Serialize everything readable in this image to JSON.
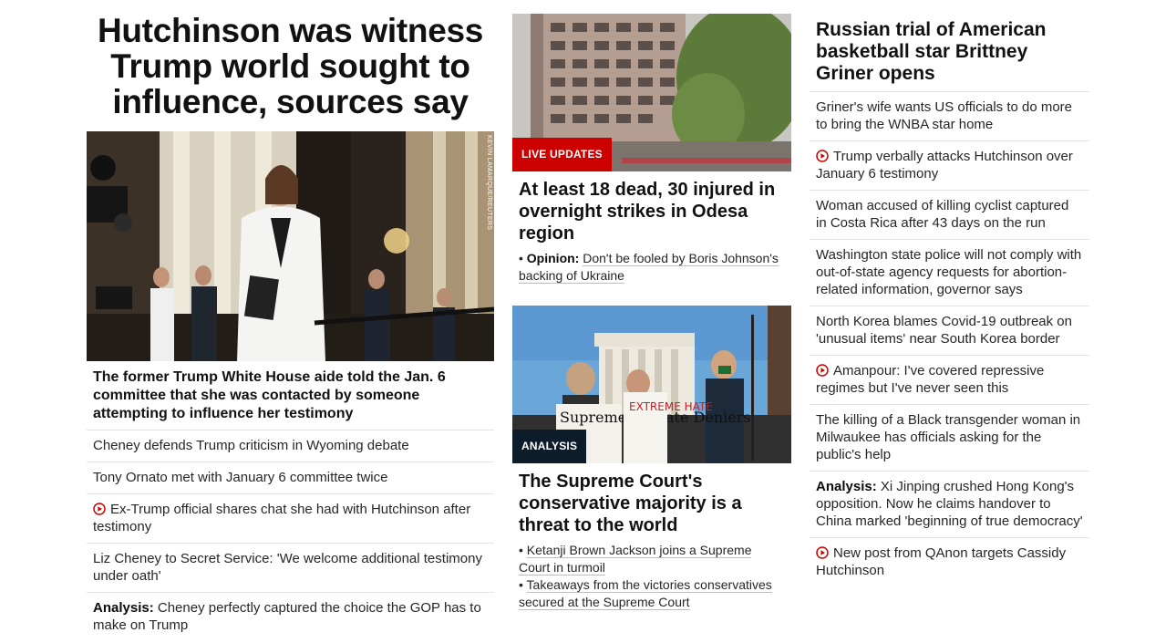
{
  "col1": {
    "headline": "Hutchinson was witness Trump world sought to influence, sources say",
    "image_credit": "KEVIN LAMARQUE/REUTERS",
    "lead": "The former Trump White House aide told the Jan. 6 committee that she was contacted by someone attempting to influence her testimony",
    "items": [
      {
        "label": "",
        "text": "Cheney defends Trump criticism in Wyoming debate",
        "video": false
      },
      {
        "label": "",
        "text": "Tony Ornato met with January 6 committee twice",
        "video": false
      },
      {
        "label": "",
        "text": "Ex-Trump official shares chat she had with Hutchinson after testimony",
        "video": true
      },
      {
        "label": "",
        "text": "Liz Cheney to Secret Service: 'We welcome additional testimony under oath'",
        "video": false
      },
      {
        "label": "Analysis:",
        "text": " Cheney perfectly captured the choice the GOP has to make on Trump",
        "video": false
      }
    ]
  },
  "col2": {
    "card1": {
      "badge": "LIVE UPDATES",
      "headline": "At least 18 dead, 30 injured in overnight strikes in Odesa region",
      "links": [
        {
          "label": "Opinion:",
          "text": "Don't be fooled by Boris Johnson's backing of Ukraine"
        }
      ]
    },
    "card2": {
      "badge": "ANALYSIS",
      "sign_text": "Supreme Climate Deniers",
      "sign_text_2": "EXTREME HATE",
      "headline": "The Supreme Court's conservative majority is a threat to the world",
      "links": [
        {
          "label": "",
          "text": "Ketanji Brown Jackson joins a Supreme Court in turmoil"
        },
        {
          "label": "",
          "text": "Takeaways from the victories conservatives secured at the Supreme Court"
        }
      ]
    }
  },
  "col3": {
    "headline": "Russian trial of American basketball star Brittney Griner opens",
    "items": [
      {
        "label": "",
        "text": "Griner's wife wants US officials to do more to bring the WNBA star home",
        "video": false
      },
      {
        "label": "",
        "text": "Trump verbally attacks Hutchinson over January 6 testimony",
        "video": true
      },
      {
        "label": "",
        "text": "Woman accused of killing cyclist captured in Costa Rica after 43 days on the run",
        "video": false
      },
      {
        "label": "",
        "text": "Washington state police will not comply with out-of-state agency requests for abortion-related information, governor says",
        "video": false
      },
      {
        "label": "",
        "text": "North Korea blames Covid-19 outbreak on 'unusual items' near South Korea border",
        "video": false
      },
      {
        "label": "",
        "text": "Amanpour: I've covered repressive regimes but I've never seen this",
        "video": true
      },
      {
        "label": "",
        "text": "The killing of a Black transgender woman in Milwaukee has officials asking for the public's help",
        "video": false
      },
      {
        "label": "Analysis:",
        "text": " Xi Jinping crushed Hong Kong's opposition. Now he claims handover to China marked 'beginning of true democracy'",
        "video": false
      },
      {
        "label": "",
        "text": "New post from QAnon targets Cassidy Hutchinson",
        "video": true
      }
    ]
  },
  "colors": {
    "live_badge": "#cc0000",
    "analysis_badge": "#0c1c2b",
    "play_icon": "#cc0000",
    "divider": "#e3e3e3"
  }
}
